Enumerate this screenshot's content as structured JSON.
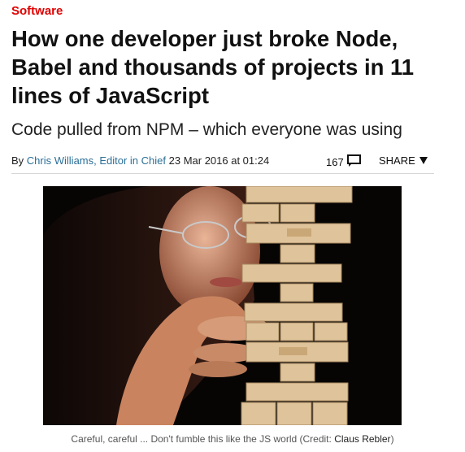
{
  "section": {
    "label": "Software"
  },
  "article": {
    "headline": "How one developer just broke Node, Babel and thousands of projects in 11 lines of JavaScript",
    "subheadline": "Code pulled from NPM – which everyone was using",
    "byline": {
      "prefix": "By",
      "author": "Chris Williams, Editor in Chief",
      "date": "23 Mar 2016 at 01:24"
    },
    "comments": {
      "count": "167",
      "icon": "comment-bubble-icon"
    },
    "share": {
      "label": "SHARE",
      "icon": "triangle-down-icon"
    }
  },
  "image": {
    "caption": "Careful, careful ... Don't fumble this like the JS world (Credit:",
    "credit": "Claus Rebler",
    "caption_end": ")"
  },
  "colors": {
    "section": "#e00000",
    "link": "#2a6f97"
  }
}
